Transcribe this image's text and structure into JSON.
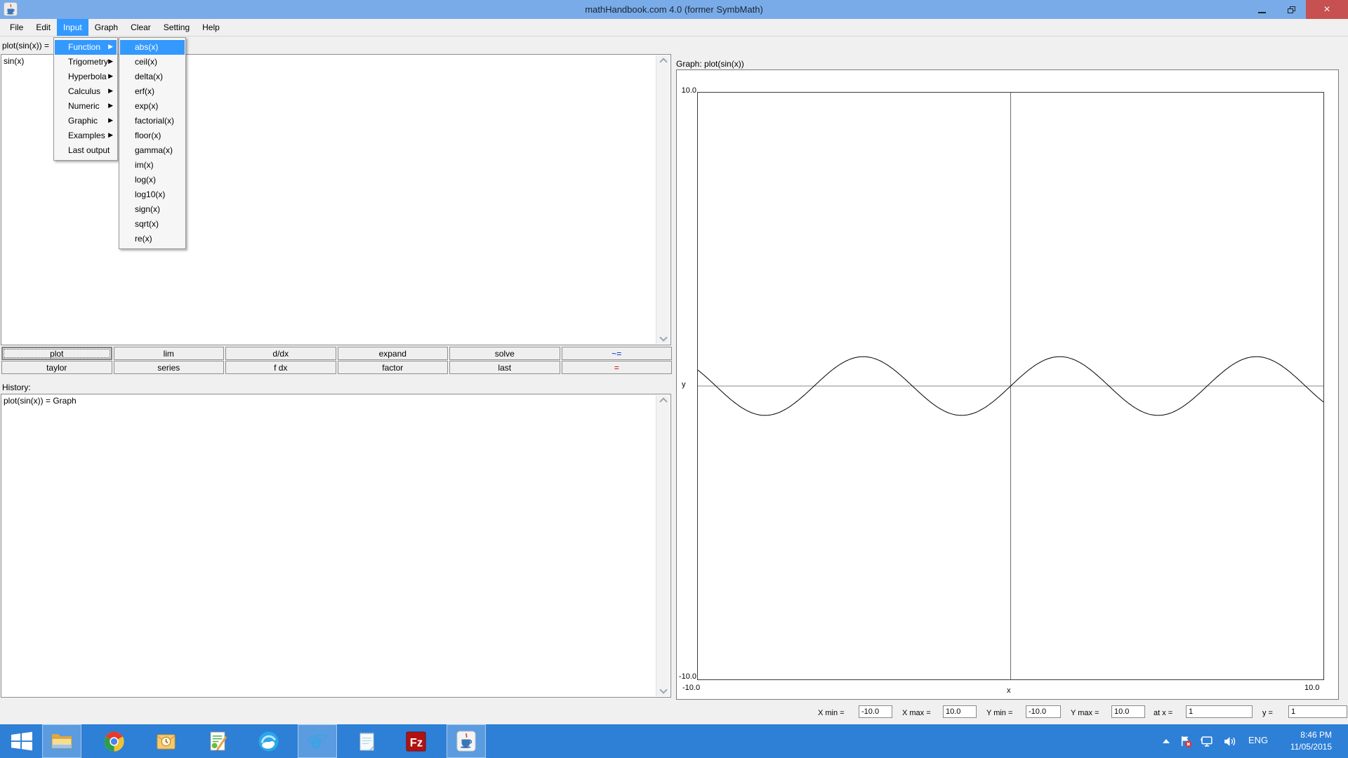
{
  "window": {
    "title": "mathHandbook.com 4.0 (former SymbMath)"
  },
  "glyphs": {
    "submenu_arrow": "▶",
    "minimize": "–",
    "close": "×"
  },
  "menu_bar": {
    "items": [
      {
        "label": "File",
        "active": false
      },
      {
        "label": "Edit",
        "active": false
      },
      {
        "label": "Input",
        "active": true
      },
      {
        "label": "Graph",
        "active": false
      },
      {
        "label": "Clear",
        "active": false
      },
      {
        "label": "Setting",
        "active": false
      },
      {
        "label": "Help",
        "active": false
      }
    ]
  },
  "input_menu": {
    "items": [
      {
        "label": "Function",
        "has_submenu": true,
        "active": true
      },
      {
        "label": "Trigometry",
        "has_submenu": true,
        "active": false
      },
      {
        "label": "Hyperbola",
        "has_submenu": true,
        "active": false
      },
      {
        "label": "Calculus",
        "has_submenu": true,
        "active": false
      },
      {
        "label": "Numeric",
        "has_submenu": true,
        "active": false
      },
      {
        "label": "Graphic",
        "has_submenu": true,
        "active": false
      },
      {
        "label": "Examples",
        "has_submenu": true,
        "active": false
      },
      {
        "label": "Last output",
        "has_submenu": false,
        "active": false
      }
    ]
  },
  "function_submenu": {
    "items": [
      {
        "label": "abs(x)",
        "active": true
      },
      {
        "label": "ceil(x)",
        "active": false
      },
      {
        "label": "delta(x)",
        "active": false
      },
      {
        "label": "erf(x)",
        "active": false
      },
      {
        "label": "exp(x)",
        "active": false
      },
      {
        "label": "factorial(x)",
        "active": false
      },
      {
        "label": "floor(x)",
        "active": false
      },
      {
        "label": "gamma(x)",
        "active": false
      },
      {
        "label": "im(x)",
        "active": false
      },
      {
        "label": "log(x)",
        "active": false
      },
      {
        "label": "log10(x)",
        "active": false
      },
      {
        "label": "sign(x)",
        "active": false
      },
      {
        "label": "sqrt(x)",
        "active": false
      },
      {
        "label": "re(x)",
        "active": false
      }
    ]
  },
  "editor": {
    "input_label": "plot(sin(x)) =",
    "input_value": "sin(x)"
  },
  "action_buttons": {
    "row1": [
      "plot",
      "lim",
      "d/dx",
      "expand",
      "solve",
      "~="
    ],
    "row2": [
      "taylor",
      "series",
      "f dx",
      "factor",
      "last",
      "="
    ]
  },
  "history": {
    "label": "History:",
    "entries": [
      "plot(sin(x)) = Graph"
    ]
  },
  "graph_panel": {
    "title": "Graph: plot(sin(x))"
  },
  "chart_data": {
    "type": "line",
    "title": "Graph: plot(sin(x))",
    "function": "sin(x)",
    "xlabel": "x",
    "ylabel": "y",
    "xlim": [
      -10,
      10
    ],
    "ylim": [
      -10,
      10
    ],
    "x_axis_line_at_y": 0,
    "y_axis_line_at_x": 0,
    "grid": false,
    "tick_labels": {
      "y_top": "10.0",
      "y_bottom": "-10.0",
      "x_left": "-10.0",
      "x_right": "10.0"
    },
    "series": [
      {
        "name": "sin(x)",
        "color": "#000000",
        "amplitude": 1,
        "period": 6.2832
      }
    ]
  },
  "range_controls": [
    {
      "label": "X min =",
      "value": "-10.0"
    },
    {
      "label": "X max =",
      "value": "10.0"
    },
    {
      "label": "Y min =",
      "value": "-10.0"
    },
    {
      "label": "Y max =",
      "value": "10.0"
    },
    {
      "label": "at x =",
      "value": "1"
    },
    {
      "label": "y =",
      "value": "1"
    }
  ],
  "taskbar": {
    "icons": [
      {
        "name": "start",
        "active": false
      },
      {
        "name": "file-explorer",
        "active": true
      },
      {
        "name": "chrome",
        "active": false
      },
      {
        "name": "outlook",
        "active": false
      },
      {
        "name": "text-editor",
        "active": false
      },
      {
        "name": "browser",
        "active": false
      },
      {
        "name": "internet-explorer",
        "active": true,
        "glyph": "e"
      },
      {
        "name": "notepad",
        "active": false
      },
      {
        "name": "filezilla",
        "active": false,
        "glyph": "Fz"
      },
      {
        "name": "java",
        "active": true
      }
    ],
    "tray": {
      "language": "ENG",
      "time": "8:46 PM",
      "date": "11/05/2015"
    }
  },
  "colors": {
    "menu_highlight": "#3399ff",
    "titlebar": "#79abe9",
    "taskbar": "#2e7fd6",
    "close_button": "#c75050",
    "approx_equals_text": "#0018cc",
    "equals_text": "#cc0000",
    "curve": "#000000"
  }
}
